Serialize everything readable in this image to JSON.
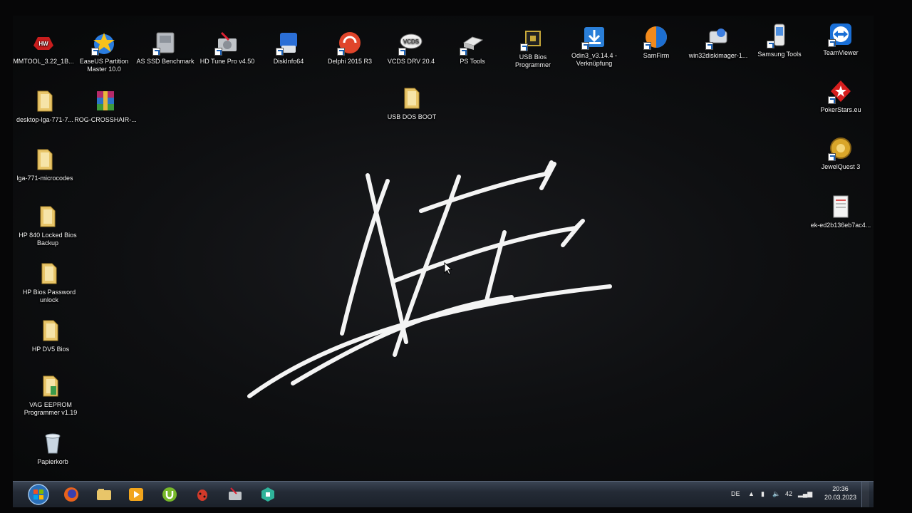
{
  "desktop": {
    "icons": [
      {
        "label": "MMTOOL_3.22_1B...",
        "icon": "red-gear-logo-icon"
      },
      {
        "label": "EaseUS Partition Master 10.0",
        "icon": "star-disk-icon"
      },
      {
        "label": "AS SSD Benchmark",
        "icon": "ssd-icon"
      },
      {
        "label": "HD Tune Pro v4.50",
        "icon": "hdd-tools-icon"
      },
      {
        "label": "DiskInfo64",
        "icon": "disk-info-icon"
      },
      {
        "label": "Delphi 2015 R3",
        "icon": "delphi-icon"
      },
      {
        "label": "VCDS DRV 20.4",
        "icon": "vcds-icon"
      },
      {
        "label": "PS Tools",
        "icon": "ps-tools-icon"
      },
      {
        "label": "USB Bios Programmer",
        "icon": "chip-icon"
      },
      {
        "label": "Odin3_v3.14.4 - Verknüpfung",
        "icon": "download-icon"
      },
      {
        "label": "SamFirm",
        "icon": "samfirm-icon"
      },
      {
        "label": "win32diskimager-1...",
        "icon": "disk-imager-icon"
      },
      {
        "label": "Samsung Tools",
        "icon": "phone-icon"
      },
      {
        "label": "TeamViewer",
        "icon": "teamviewer-icon"
      },
      {
        "label": "desktop-lga-771-7...",
        "icon": "folder-icon"
      },
      {
        "label": "ROG-CROSSHAIR-...",
        "icon": "winrar-icon"
      },
      {
        "label": "USB DOS BOOT",
        "icon": "folder-icon"
      },
      {
        "label": "lga-771-microcodes",
        "icon": "folder-icon"
      },
      {
        "label": "HP 840 Locked Bios Backup",
        "icon": "folder-icon"
      },
      {
        "label": "HP Bios Password unlock",
        "icon": "folder-icon"
      },
      {
        "label": "HP DV5 Bios",
        "icon": "folder-icon"
      },
      {
        "label": "VAG EEPROM Programmer v1.19",
        "icon": "folder-icon"
      },
      {
        "label": "Papierkorb",
        "icon": "recycle-bin-icon"
      },
      {
        "label": "PokerStars.eu",
        "icon": "pokerstars-icon"
      },
      {
        "label": "JewelQuest 3",
        "icon": "jewelquest-icon"
      },
      {
        "label": "ek-ed2b136eb7ac4...",
        "icon": "document-icon"
      }
    ]
  },
  "taskbar": {
    "pinned": [
      "start-orb-icon",
      "firefox-icon",
      "explorer-icon",
      "media-player-icon",
      "utorrent-icon",
      "bug-icon",
      "hd-tune-icon",
      "green-app-icon"
    ],
    "tray": {
      "language": "DE",
      "volume_level": "42",
      "time": "20:36",
      "date": "20.03.2023"
    }
  },
  "colors": {
    "wallpaper_bg": "#0e0f11",
    "taskbar": "#242b36",
    "folder": "#e8c569"
  }
}
